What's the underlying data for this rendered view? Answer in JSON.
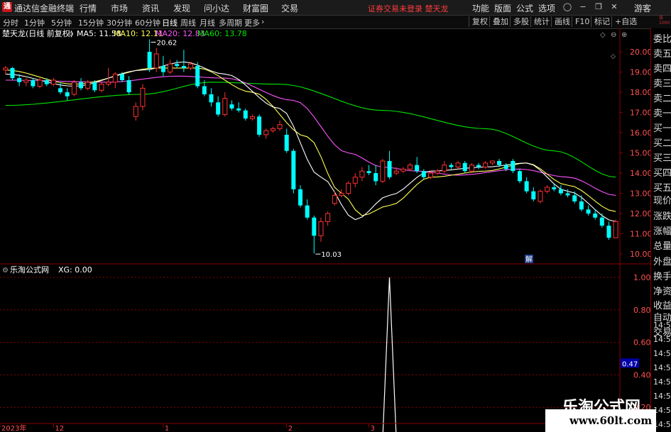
{
  "menubar": {
    "app_title": "通达信金融终端",
    "items": [
      "行情",
      "市场",
      "资讯",
      "发现",
      "问小达",
      "财富圈",
      "交易"
    ],
    "status": "证券交易未登录  楚天龙",
    "right_items": [
      "功能",
      "版面",
      "公式",
      "选项"
    ],
    "guest": "游客"
  },
  "periodbar": {
    "periods": [
      "分时",
      "1分钟",
      "5分钟",
      "15分钟",
      "30分钟",
      "60分钟",
      "日线",
      "周线",
      "月线",
      "多周期",
      "更多"
    ],
    "active": "日线",
    "tools": [
      "复权",
      "叠加",
      "多股",
      "统计",
      "画线",
      "F10",
      "标记",
      "+自选"
    ]
  },
  "main_header": {
    "stock": "楚天龙(日线 前复权)",
    "ma5": "MA5: 11.58",
    "ma10": "MA10: 12.11",
    "ma20": "MA20: 12.83",
    "ma60": "MA60: 13.78"
  },
  "sub_header": {
    "title": "乐淘公式网",
    "xg": "XG: 0.00"
  },
  "annotations": {
    "high": "20.62",
    "low": "10.03",
    "tag": "解"
  },
  "right_panel": {
    "labels": [
      "委比",
      "卖五",
      "卖四",
      "卖三",
      "卖二",
      "卖一",
      "买一",
      "买二",
      "买三",
      "买四",
      "买五",
      "现价",
      "涨跌",
      "涨幅",
      "总量",
      "外盘",
      "换手",
      "净资",
      "收益",
      "自动",
      "交易"
    ],
    "times": [
      "14:56",
      "14:56",
      "14:56",
      "14:56",
      "14:56",
      "14:56",
      "14:56",
      "14:56"
    ],
    "tiny_top": "涨\n1000"
  },
  "watermark": {
    "title": "乐淘公式网",
    "url": "www.60lt.com"
  },
  "colors": {
    "up": "#ff3232",
    "down": "#00ffff",
    "ma5": "#ffffff",
    "ma10": "#ffff54",
    "ma20": "#ff54ff",
    "ma60": "#00e600",
    "axis": "#8b0000"
  },
  "chart_data": [
    {
      "type": "candlestick",
      "ylim": [
        10,
        20.6
      ],
      "yticks": [
        20,
        19,
        18,
        17,
        16,
        15,
        14,
        13,
        12,
        11,
        10
      ],
      "x_ticks": [
        "2023年",
        "12",
        "1",
        "2",
        "3"
      ],
      "x_tick_index": [
        0,
        7,
        23,
        41,
        53
      ],
      "candles": [
        [
          19.1,
          19.3,
          18.9,
          19.2
        ],
        [
          19.2,
          19.25,
          18.6,
          18.7
        ],
        [
          18.7,
          18.9,
          18.3,
          18.5
        ],
        [
          18.5,
          18.7,
          18.3,
          18.6
        ],
        [
          18.6,
          18.7,
          18.2,
          18.3
        ],
        [
          18.3,
          18.7,
          18.2,
          18.6
        ],
        [
          18.6,
          18.7,
          18.3,
          18.4
        ],
        [
          18.4,
          18.7,
          18.3,
          18.6
        ],
        [
          18.2,
          18.5,
          17.9,
          18.0
        ],
        [
          18.0,
          18.2,
          17.6,
          17.8
        ],
        [
          17.9,
          18.6,
          17.8,
          18.5
        ],
        [
          18.5,
          18.7,
          18.1,
          18.2
        ],
        [
          18.2,
          18.6,
          18.1,
          18.5
        ],
        [
          18.5,
          18.6,
          18.0,
          18.1
        ],
        [
          18.1,
          18.5,
          18.0,
          18.4
        ],
        [
          18.4,
          19.2,
          18.3,
          18.5
        ],
        [
          18.5,
          19.0,
          18.2,
          18.9
        ],
        [
          18.9,
          19.0,
          18.5,
          18.6
        ],
        [
          18.6,
          18.8,
          17.9,
          18.0
        ],
        [
          16.8,
          17.5,
          16.6,
          17.3
        ],
        [
          17.3,
          18.4,
          17.1,
          18.2
        ],
        [
          20.0,
          20.62,
          19.0,
          19.2
        ],
        [
          19.2,
          20.2,
          19.0,
          19.9
        ],
        [
          19.3,
          19.8,
          18.8,
          19.0
        ],
        [
          19.0,
          19.6,
          18.9,
          19.4
        ],
        [
          19.4,
          19.6,
          19.2,
          19.3
        ],
        [
          19.3,
          20.1,
          19.0,
          19.2
        ],
        [
          19.2,
          19.5,
          19.1,
          19.4
        ],
        [
          19.3,
          19.5,
          18.2,
          18.3
        ],
        [
          18.3,
          18.6,
          17.8,
          17.9
        ],
        [
          17.9,
          18.2,
          17.3,
          17.5
        ],
        [
          17.5,
          17.8,
          16.8,
          16.9
        ],
        [
          16.9,
          18.0,
          16.8,
          17.7
        ],
        [
          17.4,
          17.6,
          17.1,
          17.2
        ],
        [
          17.2,
          17.5,
          17.0,
          17.1
        ],
        [
          17.1,
          17.2,
          16.6,
          16.7
        ],
        [
          16.7,
          16.9,
          16.6,
          16.8
        ],
        [
          16.8,
          16.9,
          15.8,
          15.9
        ],
        [
          15.9,
          16.2,
          15.7,
          16.1
        ],
        [
          16.1,
          16.3,
          16.0,
          16.2
        ],
        [
          16.2,
          16.6,
          16.1,
          16.4
        ],
        [
          15.9,
          16.2,
          15.0,
          15.1
        ],
        [
          15.1,
          15.2,
          13.0,
          13.2
        ],
        [
          13.2,
          13.4,
          12.3,
          12.4
        ],
        [
          12.4,
          12.7,
          11.7,
          11.8
        ],
        [
          11.8,
          11.9,
          10.03,
          10.9
        ],
        [
          10.9,
          11.8,
          10.6,
          11.6
        ],
        [
          11.6,
          12.1,
          11.4,
          12.0
        ],
        [
          12.5,
          13.1,
          12.4,
          12.9
        ],
        [
          12.9,
          13.2,
          12.8,
          13.0
        ],
        [
          13.0,
          13.6,
          12.9,
          13.5
        ],
        [
          13.5,
          14.0,
          13.3,
          13.8
        ],
        [
          13.8,
          14.3,
          13.6,
          14.1
        ],
        [
          14.1,
          14.4,
          13.9,
          14.0
        ],
        [
          14.0,
          14.4,
          13.4,
          13.6
        ],
        [
          13.6,
          14.7,
          13.5,
          14.6
        ],
        [
          14.6,
          15.1,
          13.7,
          13.8
        ],
        [
          14.0,
          14.3,
          13.9,
          14.1
        ],
        [
          14.1,
          14.3,
          14.0,
          14.2
        ],
        [
          14.2,
          14.5,
          14.1,
          14.4
        ],
        [
          14.4,
          14.8,
          14.0,
          14.1
        ],
        [
          14.1,
          14.2,
          13.7,
          13.8
        ],
        [
          13.8,
          14.1,
          13.7,
          14.0
        ],
        [
          14.0,
          14.2,
          13.9,
          14.1
        ],
        [
          14.1,
          14.6,
          14.0,
          14.4
        ],
        [
          14.4,
          14.5,
          14.2,
          14.3
        ],
        [
          14.3,
          14.6,
          14.2,
          14.5
        ],
        [
          14.5,
          14.6,
          14.0,
          14.1
        ],
        [
          14.1,
          14.5,
          14.0,
          14.4
        ],
        [
          14.4,
          14.5,
          14.2,
          14.3
        ],
        [
          14.3,
          14.6,
          14.2,
          14.5
        ],
        [
          14.5,
          14.6,
          14.4,
          14.6
        ],
        [
          14.6,
          14.7,
          14.3,
          14.4
        ],
        [
          14.4,
          14.5,
          14.1,
          14.2
        ],
        [
          14.6,
          14.7,
          14.0,
          14.1
        ],
        [
          14.1,
          14.2,
          13.5,
          13.6
        ]
      ],
      "candles_tail": [
        [
          13.6,
          13.8,
          13.0,
          13.1
        ],
        [
          13.1,
          13.3,
          12.6,
          12.7
        ],
        [
          12.6,
          13.2,
          12.5,
          13.1
        ],
        [
          13.1,
          13.4,
          13.0,
          13.3
        ],
        [
          13.3,
          13.5,
          13.1,
          13.2
        ],
        [
          13.2,
          13.4,
          12.9,
          13.0
        ],
        [
          13.0,
          13.2,
          12.8,
          12.9
        ],
        [
          12.9,
          13.1,
          12.5,
          12.6
        ],
        [
          12.6,
          12.9,
          12.1,
          12.2
        ],
        [
          12.2,
          12.4,
          11.9,
          12.0
        ],
        [
          12.0,
          12.2,
          11.7,
          11.8
        ],
        [
          11.8,
          12.0,
          11.3,
          11.4
        ],
        [
          11.4,
          11.6,
          10.7,
          10.8
        ],
        [
          10.8,
          11.7,
          10.8,
          11.6
        ]
      ],
      "ma60": [
        [
          0,
          17.35
        ],
        [
          20,
          17.9
        ],
        [
          30,
          18.5
        ],
        [
          40,
          18.4
        ],
        [
          55,
          17.1
        ],
        [
          70,
          16.2
        ],
        [
          80,
          15.1
        ],
        [
          89,
          13.8
        ]
      ],
      "ma20": [
        [
          0,
          18.6
        ],
        [
          15,
          18.5
        ],
        [
          25,
          18.8
        ],
        [
          32,
          18.7
        ],
        [
          42,
          17.6
        ],
        [
          50,
          15.0
        ],
        [
          55,
          14.3
        ],
        [
          60,
          14.1
        ],
        [
          66,
          13.9
        ],
        [
          75,
          14.2
        ],
        [
          82,
          13.8
        ],
        [
          89,
          12.9
        ]
      ],
      "ma10": [
        [
          0,
          19.1
        ],
        [
          10,
          18.4
        ],
        [
          22,
          19.2
        ],
        [
          28,
          19.2
        ],
        [
          36,
          18.0
        ],
        [
          44,
          15.8
        ],
        [
          49,
          13.0
        ],
        [
          52,
          11.9
        ],
        [
          56,
          12.4
        ],
        [
          62,
          13.8
        ],
        [
          70,
          14.1
        ],
        [
          76,
          14.5
        ],
        [
          82,
          13.4
        ],
        [
          89,
          12.1
        ]
      ],
      "ma5": [
        [
          0,
          18.9
        ],
        [
          10,
          18.3
        ],
        [
          20,
          19.1
        ],
        [
          26,
          19.5
        ],
        [
          32,
          18.9
        ],
        [
          40,
          17.2
        ],
        [
          46,
          13.8
        ],
        [
          51,
          11.7
        ],
        [
          56,
          12.9
        ],
        [
          62,
          14.1
        ],
        [
          70,
          14.3
        ],
        [
          76,
          14.5
        ],
        [
          82,
          13.1
        ],
        [
          89,
          11.6
        ]
      ]
    },
    {
      "type": "line",
      "title": "XG",
      "ylim": [
        0,
        1
      ],
      "yticks": [
        1.0,
        0.8,
        0.6,
        0.4,
        0.2
      ],
      "current_value_label": "0.47",
      "signal_index": 56,
      "values_note": "0 everywhere except a single spike to 1.00 at signal_index"
    }
  ]
}
